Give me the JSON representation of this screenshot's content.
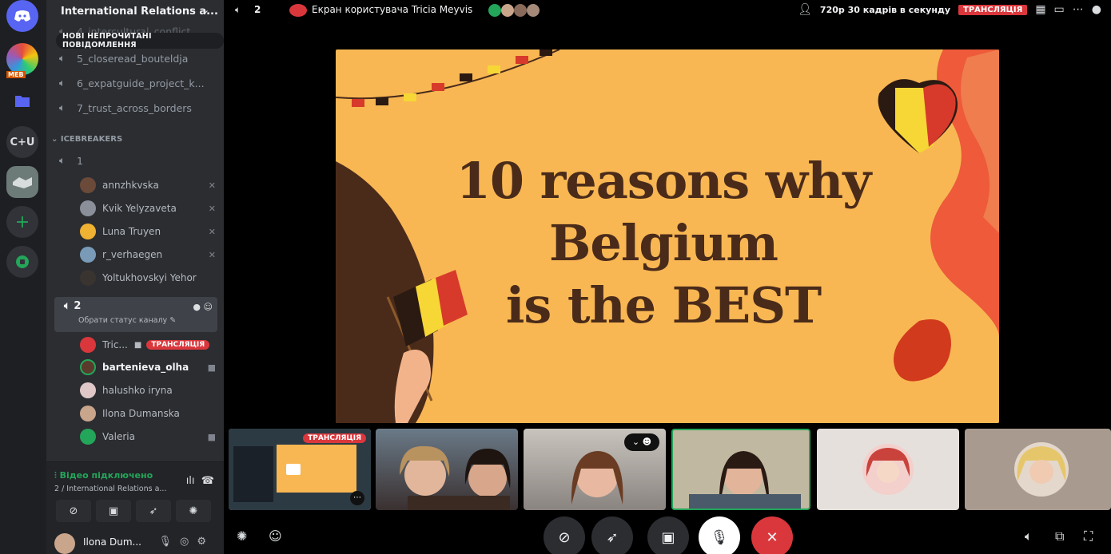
{
  "server_rail": {
    "items": [
      {
        "icon": "discord-logo-icon"
      },
      {
        "icon": "server-meb-icon",
        "label": "MEB"
      },
      {
        "icon": "folder-icon"
      },
      {
        "icon": "server-text-icon",
        "label": "C+U"
      },
      {
        "icon": "server-handshake-icon"
      },
      {
        "icon": "add-server-icon",
        "label": "+"
      },
      {
        "icon": "explore-icon"
      }
    ]
  },
  "sidebar": {
    "server_name": "International Relations a...",
    "unread_banner": "НОВІ НЕПРОЧИТАНІ ПОВІДОМЛЕННЯ",
    "channels": [
      {
        "label": "4_intercultural_conflict"
      },
      {
        "label": "5_closeread_bouteldja"
      },
      {
        "label": "6_expatguide_project_k..."
      },
      {
        "label": "7_trust_across_borders"
      }
    ],
    "category": "ICEBREAKERS",
    "voice_channel_1": {
      "label": "1",
      "members": [
        "annzhkvska",
        "Kvik Yelyzaveta",
        "Luna Truyen",
        "r_verhaegen",
        "Yoltukhovskyi Yehor"
      ]
    },
    "voice_channel_2": {
      "label": "2",
      "status_placeholder": "Обрати статус каналу",
      "members": [
        {
          "name": "Tric...",
          "live": "ТРАНСЛЯЦІЯ"
        },
        {
          "name": "bartenieva_olha"
        },
        {
          "name": "halushko iryna"
        },
        {
          "name": "Ilona Dumanska"
        },
        {
          "name": "Valeria"
        }
      ]
    }
  },
  "voice_panel": {
    "status": "Відео підключено",
    "subtitle": "2 / International Relations a..."
  },
  "user_panel": {
    "name": "Ilona Dum..."
  },
  "topbar": {
    "channel_count": "2",
    "title": "Екран користувача Tricia Meyvis",
    "quality": "720p 30 кадрів в секунду",
    "live": "ТРАНСЛЯЦІЯ"
  },
  "slide": {
    "title_line1": "10 reasons why",
    "title_line2": "Belgium",
    "title_line3": "is the BEST"
  },
  "thumbnails": {
    "stream_badge": "ТРАНСЛЯЦІЯ"
  },
  "colors": {
    "discord_bg": "#2b2d31",
    "rail_bg": "#1e1f22",
    "live_red": "#da373c",
    "connected_green": "#23a55a",
    "slide_bg": "#f8b753",
    "slide_text": "#4a2b1a"
  }
}
